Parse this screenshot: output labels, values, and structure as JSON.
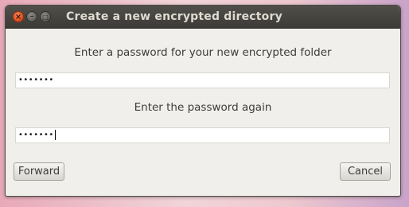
{
  "window": {
    "title": "Create a new encrypted directory",
    "controls": {
      "close_glyph": "×",
      "minimize_glyph": "–",
      "maximize_glyph": "□"
    }
  },
  "form": {
    "password_prompt": "Enter a password for your new encrypted folder",
    "password_value": "•••••••",
    "confirm_prompt": "Enter the password again",
    "confirm_value": "•••••••"
  },
  "buttons": {
    "forward_label": "Forward",
    "cancel_label": "Cancel"
  },
  "colors": {
    "titlebar": "#3c3b37",
    "dialog_background": "#f0efeb",
    "close_button": "#de4a16"
  }
}
